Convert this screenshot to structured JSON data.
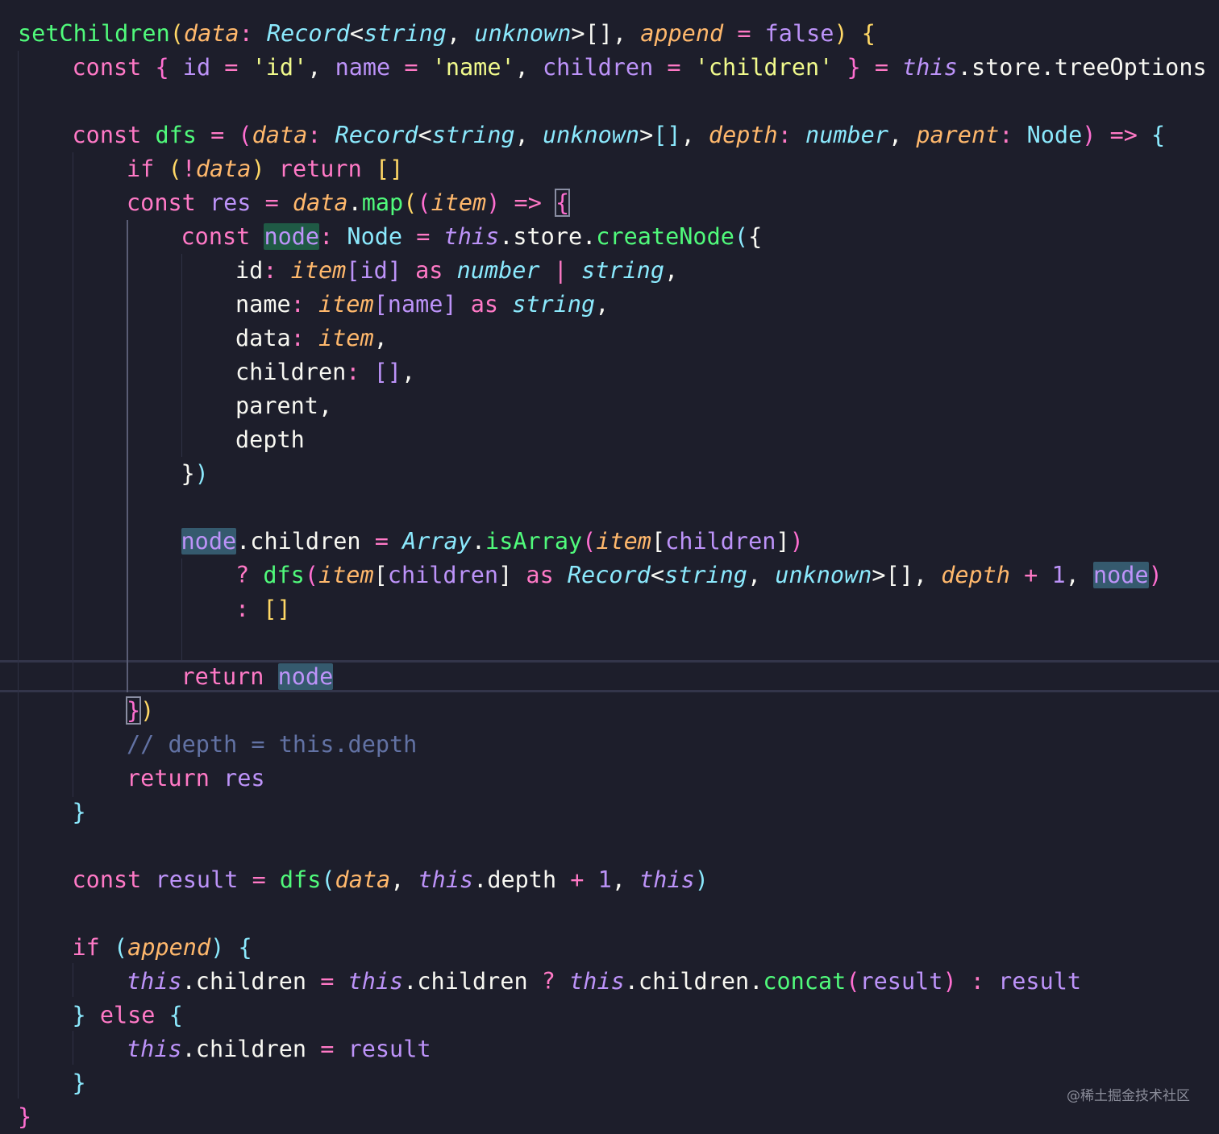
{
  "editor": {
    "theme": "dracula-style",
    "colors": {
      "background": "#1d1e2b",
      "keyword": "#ff79c6",
      "function": "#50fa7b",
      "type": "#8be9fd",
      "parameter": "#ffb86c",
      "string": "#f1fa8c",
      "this": "#bd93f9",
      "comment": "#6272a4"
    },
    "lines": [
      {
        "indent": 0,
        "tokens": [
          {
            "t": "setChildren",
            "c": "fn"
          },
          {
            "t": "(",
            "c": "b1"
          },
          {
            "t": "data",
            "c": "pa"
          },
          {
            "t": ": ",
            "c": "op"
          },
          {
            "t": "Record",
            "c": "ty"
          },
          {
            "t": "<",
            "c": "pu"
          },
          {
            "t": "string",
            "c": "ty"
          },
          {
            "t": ", ",
            "c": "pu"
          },
          {
            "t": "unknown",
            "c": "ty"
          },
          {
            "t": ">[], ",
            "c": "pu"
          },
          {
            "t": "append",
            "c": "pa"
          },
          {
            "t": " = ",
            "c": "op"
          },
          {
            "t": "false",
            "c": "nu"
          },
          {
            "t": ") ",
            "c": "b1"
          },
          {
            "t": "{",
            "c": "b1"
          }
        ]
      },
      {
        "indent": 1,
        "tokens": [
          {
            "t": "const ",
            "c": "kw"
          },
          {
            "t": "{ ",
            "c": "b2"
          },
          {
            "t": "id",
            "c": "va"
          },
          {
            "t": " = ",
            "c": "op"
          },
          {
            "t": "'id'",
            "c": "st"
          },
          {
            "t": ", ",
            "c": "pu"
          },
          {
            "t": "name",
            "c": "va"
          },
          {
            "t": " = ",
            "c": "op"
          },
          {
            "t": "'name'",
            "c": "st"
          },
          {
            "t": ", ",
            "c": "pu"
          },
          {
            "t": "children",
            "c": "va"
          },
          {
            "t": " = ",
            "c": "op"
          },
          {
            "t": "'children'",
            "c": "st"
          },
          {
            "t": " } ",
            "c": "b2"
          },
          {
            "t": "= ",
            "c": "op"
          },
          {
            "t": "this",
            "c": "th"
          },
          {
            "t": ".store.treeOptions",
            "c": "pr"
          }
        ]
      },
      {
        "indent": 0,
        "tokens": []
      },
      {
        "indent": 1,
        "tokens": [
          {
            "t": "const ",
            "c": "kw"
          },
          {
            "t": "dfs",
            "c": "fn"
          },
          {
            "t": " = ",
            "c": "op"
          },
          {
            "t": "(",
            "c": "b2"
          },
          {
            "t": "data",
            "c": "pa"
          },
          {
            "t": ": ",
            "c": "op"
          },
          {
            "t": "Record",
            "c": "ty"
          },
          {
            "t": "<",
            "c": "pu"
          },
          {
            "t": "string",
            "c": "ty"
          },
          {
            "t": ", ",
            "c": "pu"
          },
          {
            "t": "unknown",
            "c": "ty"
          },
          {
            "t": ">",
            "c": "pu"
          },
          {
            "t": "[]",
            "c": "b3"
          },
          {
            "t": ", ",
            "c": "pu"
          },
          {
            "t": "depth",
            "c": "pa"
          },
          {
            "t": ": ",
            "c": "op"
          },
          {
            "t": "number",
            "c": "ty"
          },
          {
            "t": ", ",
            "c": "pu"
          },
          {
            "t": "parent",
            "c": "pa"
          },
          {
            "t": ": ",
            "c": "op"
          },
          {
            "t": "Node",
            "c": "cl"
          },
          {
            "t": ") ",
            "c": "b2"
          },
          {
            "t": "=> ",
            "c": "kw"
          },
          {
            "t": "{",
            "c": "b3"
          }
        ]
      },
      {
        "indent": 2,
        "tokens": [
          {
            "t": "if ",
            "c": "kw"
          },
          {
            "t": "(",
            "c": "b1"
          },
          {
            "t": "!",
            "c": "op"
          },
          {
            "t": "data",
            "c": "pa"
          },
          {
            "t": ") ",
            "c": "b1"
          },
          {
            "t": "return ",
            "c": "kw"
          },
          {
            "t": "[]",
            "c": "b1"
          }
        ]
      },
      {
        "indent": 2,
        "tokens": [
          {
            "t": "const ",
            "c": "kw"
          },
          {
            "t": "res",
            "c": "va"
          },
          {
            "t": " = ",
            "c": "op"
          },
          {
            "t": "data",
            "c": "pa"
          },
          {
            "t": ".",
            "c": "pu"
          },
          {
            "t": "map",
            "c": "fn"
          },
          {
            "t": "(",
            "c": "b1"
          },
          {
            "t": "(",
            "c": "b2"
          },
          {
            "t": "item",
            "c": "pa"
          },
          {
            "t": ") ",
            "c": "b2"
          },
          {
            "t": "=> ",
            "c": "kw"
          },
          {
            "t": "{",
            "c": "b2",
            "x": "bm"
          }
        ]
      },
      {
        "indent": 3,
        "tokens": [
          {
            "t": "const ",
            "c": "kw"
          },
          {
            "t": "node",
            "c": "va",
            "x": "hl-def"
          },
          {
            "t": ": ",
            "c": "op"
          },
          {
            "t": "Node",
            "c": "cl"
          },
          {
            "t": " = ",
            "c": "op"
          },
          {
            "t": "this",
            "c": "th"
          },
          {
            "t": ".store.",
            "c": "pr"
          },
          {
            "t": "createNode",
            "c": "fn"
          },
          {
            "t": "(",
            "c": "b3"
          },
          {
            "t": "{",
            "c": "pu"
          }
        ]
      },
      {
        "indent": 4,
        "tokens": [
          {
            "t": "id",
            "c": "pr"
          },
          {
            "t": ": ",
            "c": "op"
          },
          {
            "t": "item",
            "c": "pa"
          },
          {
            "t": "[",
            "c": "va"
          },
          {
            "t": "id",
            "c": "va"
          },
          {
            "t": "] ",
            "c": "va"
          },
          {
            "t": "as ",
            "c": "kw"
          },
          {
            "t": "number",
            "c": "ty"
          },
          {
            "t": " | ",
            "c": "op"
          },
          {
            "t": "string",
            "c": "ty"
          },
          {
            "t": ",",
            "c": "pu"
          }
        ]
      },
      {
        "indent": 4,
        "tokens": [
          {
            "t": "name",
            "c": "pr"
          },
          {
            "t": ": ",
            "c": "op"
          },
          {
            "t": "item",
            "c": "pa"
          },
          {
            "t": "[",
            "c": "va"
          },
          {
            "t": "name",
            "c": "va"
          },
          {
            "t": "] ",
            "c": "va"
          },
          {
            "t": "as ",
            "c": "kw"
          },
          {
            "t": "string",
            "c": "ty"
          },
          {
            "t": ",",
            "c": "pu"
          }
        ]
      },
      {
        "indent": 4,
        "tokens": [
          {
            "t": "data",
            "c": "pr"
          },
          {
            "t": ": ",
            "c": "op"
          },
          {
            "t": "item",
            "c": "pa"
          },
          {
            "t": ",",
            "c": "pu"
          }
        ]
      },
      {
        "indent": 4,
        "tokens": [
          {
            "t": "children",
            "c": "pr"
          },
          {
            "t": ": ",
            "c": "op"
          },
          {
            "t": "[]",
            "c": "va"
          },
          {
            "t": ",",
            "c": "pu"
          }
        ]
      },
      {
        "indent": 4,
        "tokens": [
          {
            "t": "parent,",
            "c": "pr"
          }
        ]
      },
      {
        "indent": 4,
        "tokens": [
          {
            "t": "depth",
            "c": "pr"
          }
        ]
      },
      {
        "indent": 3,
        "tokens": [
          {
            "t": "}",
            "c": "pu"
          },
          {
            "t": ")",
            "c": "b3"
          }
        ]
      },
      {
        "indent": 0,
        "tokens": []
      },
      {
        "indent": 3,
        "tokens": [
          {
            "t": "node",
            "c": "va",
            "x": "hl-ref"
          },
          {
            "t": ".children",
            "c": "pr"
          },
          {
            "t": " = ",
            "c": "op"
          },
          {
            "t": "Array",
            "c": "ty"
          },
          {
            "t": ".",
            "c": "pu"
          },
          {
            "t": "isArray",
            "c": "fn"
          },
          {
            "t": "(",
            "c": "b2"
          },
          {
            "t": "item",
            "c": "pa"
          },
          {
            "t": "[",
            "c": "pu"
          },
          {
            "t": "children",
            "c": "va"
          },
          {
            "t": "]",
            "c": "pu"
          },
          {
            "t": ")",
            "c": "b2"
          }
        ]
      },
      {
        "indent": 4,
        "tokens": [
          {
            "t": "? ",
            "c": "op"
          },
          {
            "t": "dfs",
            "c": "fn"
          },
          {
            "t": "(",
            "c": "b2"
          },
          {
            "t": "item",
            "c": "pa"
          },
          {
            "t": "[",
            "c": "pu"
          },
          {
            "t": "children",
            "c": "va"
          },
          {
            "t": "] ",
            "c": "pu"
          },
          {
            "t": "as ",
            "c": "kw"
          },
          {
            "t": "Record",
            "c": "ty"
          },
          {
            "t": "<",
            "c": "pu"
          },
          {
            "t": "string",
            "c": "ty"
          },
          {
            "t": ", ",
            "c": "pu"
          },
          {
            "t": "unknown",
            "c": "ty"
          },
          {
            "t": ">[], ",
            "c": "pu"
          },
          {
            "t": "depth",
            "c": "pa"
          },
          {
            "t": " + ",
            "c": "op"
          },
          {
            "t": "1",
            "c": "nu"
          },
          {
            "t": ", ",
            "c": "pu"
          },
          {
            "t": "node",
            "c": "va",
            "x": "hl-ref"
          },
          {
            "t": ")",
            "c": "b2"
          }
        ]
      },
      {
        "indent": 4,
        "tokens": [
          {
            "t": ": ",
            "c": "op"
          },
          {
            "t": "[]",
            "c": "b1"
          }
        ]
      },
      {
        "indent": 0,
        "tokens": []
      },
      {
        "indent": 3,
        "tokens": [
          {
            "t": "return ",
            "c": "kw"
          },
          {
            "t": "node",
            "c": "va",
            "x": "hl-ref"
          }
        ]
      },
      {
        "indent": 2,
        "tokens": [
          {
            "t": "}",
            "c": "b2",
            "x": "bm"
          },
          {
            "t": ")",
            "c": "b1"
          }
        ]
      },
      {
        "indent": 2,
        "tokens": [
          {
            "t": "// depth = this.depth",
            "c": "co"
          }
        ]
      },
      {
        "indent": 2,
        "tokens": [
          {
            "t": "return ",
            "c": "kw"
          },
          {
            "t": "res",
            "c": "va"
          }
        ]
      },
      {
        "indent": 1,
        "tokens": [
          {
            "t": "}",
            "c": "b3"
          }
        ]
      },
      {
        "indent": 0,
        "tokens": []
      },
      {
        "indent": 1,
        "tokens": [
          {
            "t": "const ",
            "c": "kw"
          },
          {
            "t": "result",
            "c": "va"
          },
          {
            "t": " = ",
            "c": "op"
          },
          {
            "t": "dfs",
            "c": "fn"
          },
          {
            "t": "(",
            "c": "b3"
          },
          {
            "t": "data",
            "c": "pa"
          },
          {
            "t": ", ",
            "c": "pu"
          },
          {
            "t": "this",
            "c": "th"
          },
          {
            "t": ".depth",
            "c": "pr"
          },
          {
            "t": " + ",
            "c": "op"
          },
          {
            "t": "1",
            "c": "nu"
          },
          {
            "t": ", ",
            "c": "pu"
          },
          {
            "t": "this",
            "c": "th"
          },
          {
            "t": ")",
            "c": "b3"
          }
        ]
      },
      {
        "indent": 0,
        "tokens": []
      },
      {
        "indent": 1,
        "tokens": [
          {
            "t": "if ",
            "c": "kw"
          },
          {
            "t": "(",
            "c": "b3"
          },
          {
            "t": "append",
            "c": "pa"
          },
          {
            "t": ") ",
            "c": "b3"
          },
          {
            "t": "{",
            "c": "b3"
          }
        ]
      },
      {
        "indent": 2,
        "tokens": [
          {
            "t": "this",
            "c": "th"
          },
          {
            "t": ".children",
            "c": "pr"
          },
          {
            "t": " = ",
            "c": "op"
          },
          {
            "t": "this",
            "c": "th"
          },
          {
            "t": ".children",
            "c": "pr"
          },
          {
            "t": " ? ",
            "c": "op"
          },
          {
            "t": "this",
            "c": "th"
          },
          {
            "t": ".children.",
            "c": "pr"
          },
          {
            "t": "concat",
            "c": "fn"
          },
          {
            "t": "(",
            "c": "b2"
          },
          {
            "t": "result",
            "c": "va"
          },
          {
            "t": ")",
            "c": "b2"
          },
          {
            "t": " : ",
            "c": "op"
          },
          {
            "t": "result",
            "c": "va"
          }
        ]
      },
      {
        "indent": 1,
        "tokens": [
          {
            "t": "} ",
            "c": "b3"
          },
          {
            "t": "else ",
            "c": "kw"
          },
          {
            "t": "{",
            "c": "b3"
          }
        ]
      },
      {
        "indent": 2,
        "tokens": [
          {
            "t": "this",
            "c": "th"
          },
          {
            "t": ".children",
            "c": "pr"
          },
          {
            "t": " = ",
            "c": "op"
          },
          {
            "t": "result",
            "c": "va"
          }
        ]
      },
      {
        "indent": 1,
        "tokens": [
          {
            "t": "}",
            "c": "b3"
          }
        ]
      },
      {
        "indent": 0,
        "tokens": [
          {
            "t": "}",
            "c": "b2"
          }
        ]
      }
    ]
  },
  "watermark": "@稀土掘金技术社区"
}
